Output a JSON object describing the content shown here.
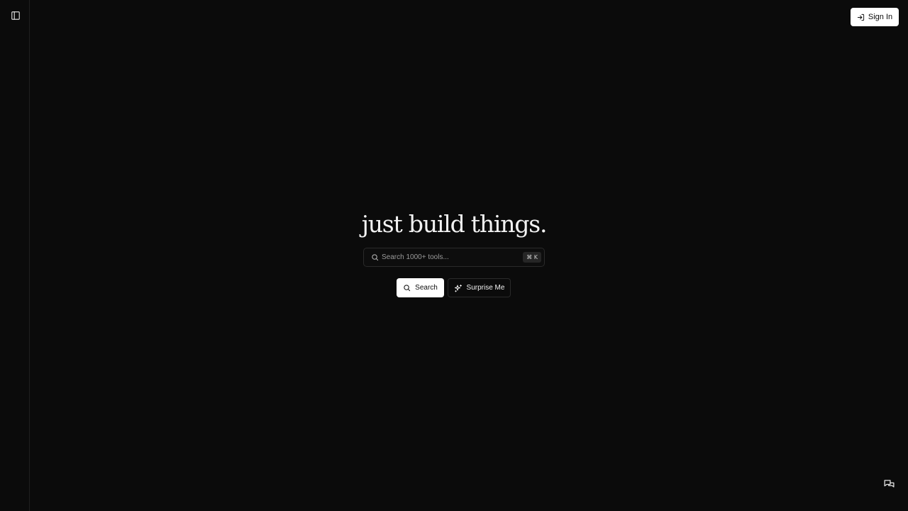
{
  "header": {
    "sign_in_label": "Sign In"
  },
  "hero": {
    "title": "just build things."
  },
  "search": {
    "placeholder": "Search 1000+ tools...",
    "shortcut": "⌘ K",
    "search_button_label": "Search",
    "surprise_button_label": "Surprise Me"
  },
  "icons": {
    "sidebar_toggle": "sidebar-panel-icon",
    "sign_in": "log-in-icon",
    "search": "search-icon",
    "surprise": "sparkles-icon",
    "feedback": "chat-bubbles-icon"
  },
  "colors": {
    "background": "#0b0b0b",
    "primary_button": "#ffffff",
    "border": "#2a2a2a"
  }
}
